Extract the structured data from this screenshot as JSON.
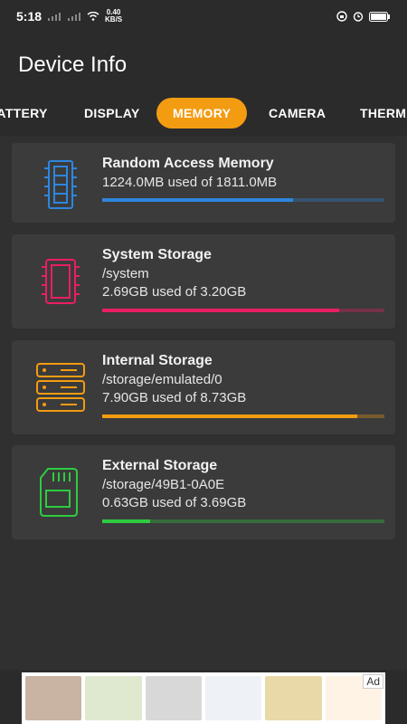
{
  "status_bar": {
    "time": "5:18",
    "net_speed_value": "0.40",
    "net_speed_unit": "KB/S",
    "battery_icon": "battery-icon",
    "alarm_icon": "alarm-icon"
  },
  "app": {
    "title": "Device Info"
  },
  "tabs": [
    {
      "label": "BATTERY"
    },
    {
      "label": "DISPLAY"
    },
    {
      "label": "MEMORY",
      "active": true
    },
    {
      "label": "CAMERA"
    },
    {
      "label": "THERMAL"
    }
  ],
  "cards": [
    {
      "title": "Random Access Memory",
      "lines": [
        "1224.0MB used of 1811.0MB"
      ],
      "used_fraction": 0.676,
      "color": "#2e86de",
      "icon": "ram-icon"
    },
    {
      "title": "System Storage",
      "lines": [
        "/system",
        "2.69GB used of 3.20GB"
      ],
      "used_fraction": 0.84,
      "color": "#e91e63",
      "icon": "cpu-chip-icon"
    },
    {
      "title": "Internal Storage",
      "lines": [
        "/storage/emulated/0",
        "7.90GB used of 8.73GB"
      ],
      "used_fraction": 0.905,
      "color": "#f39c12",
      "icon": "server-icon"
    },
    {
      "title": "External Storage",
      "lines": [
        "/storage/49B1-0A0E",
        "0.63GB used of 3.69GB"
      ],
      "used_fraction": 0.171,
      "color": "#2ecc40",
      "icon": "sd-card-icon"
    }
  ],
  "ad": {
    "label": "Ad"
  }
}
